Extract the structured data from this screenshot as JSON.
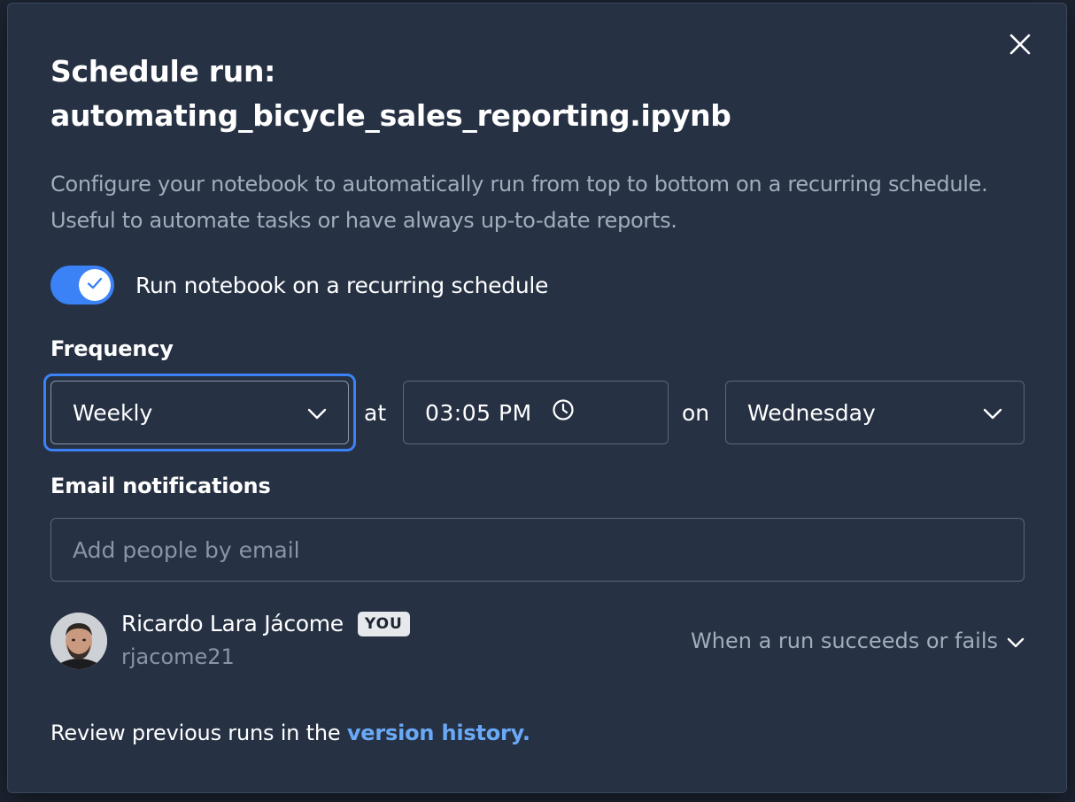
{
  "dialog": {
    "title_line1": "Schedule run:",
    "title_line2": "automating_bicycle_sales_reporting.ipynb",
    "description": "Configure your notebook to automatically run from top to bottom on a recurring schedule. Useful to automate tasks or have always up-to-date reports."
  },
  "toggle": {
    "label": "Run notebook on a recurring schedule",
    "checked": true
  },
  "frequency": {
    "label": "Frequency",
    "value": "Weekly",
    "at_word": "at",
    "time": "03:05 PM",
    "on_word": "on",
    "day": "Wednesday"
  },
  "email": {
    "label": "Email notifications",
    "placeholder": "Add people by email"
  },
  "user": {
    "name": "Ricardo Lara Jácome",
    "badge": "YOU",
    "handle": "rjacome21",
    "notify_option": "When a run succeeds or fails"
  },
  "footer": {
    "text": "Review previous runs in the ",
    "link": "version history."
  },
  "colors": {
    "accent": "#3b82f6",
    "link": "#6aa9f5",
    "modal_bg": "#263144"
  },
  "icons": [
    "close-icon",
    "check-icon",
    "chevron-down-icon",
    "clock-icon"
  ]
}
